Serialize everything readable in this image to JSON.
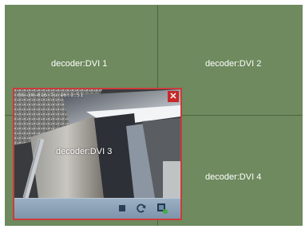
{
  "wall": {
    "cells": [
      {
        "label": "decoder:DVI 1"
      },
      {
        "label": "decoder:DVI 2"
      },
      {
        "label": "decoder:DVI 3"
      },
      {
        "label": "decoder:DVI 4"
      }
    ]
  },
  "preview": {
    "timestamp": "08-30-016 Tu 16:1:51",
    "overlay_label": "decoder:DVI 3",
    "close_symbol": "✕",
    "toolbar": [
      {
        "icon": "stop-icon"
      },
      {
        "icon": "refresh-icon"
      },
      {
        "icon": "snapshot-icon"
      }
    ]
  },
  "colors": {
    "wall": "#6e8a5e",
    "grid_line": "#4e6644",
    "selected_border": "#cc3b3b",
    "toolbar": "#8aa0b6"
  }
}
